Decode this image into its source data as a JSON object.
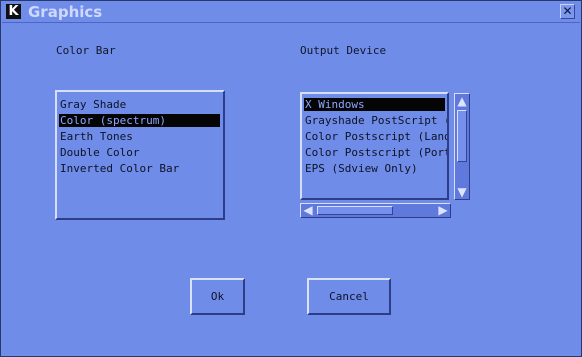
{
  "window": {
    "title": "Graphics",
    "app_icon": "K",
    "close_symbol": "✕"
  },
  "sections": {
    "color_bar": {
      "label": "Color Bar",
      "items": [
        {
          "label": "Gray Shade",
          "selected": false
        },
        {
          "label": "Color (spectrum)",
          "selected": true
        },
        {
          "label": "Earth Tones",
          "selected": false
        },
        {
          "label": "Double Color",
          "selected": false
        },
        {
          "label": "Inverted Color Bar",
          "selected": false
        }
      ]
    },
    "output_device": {
      "label": "Output Device",
      "items": [
        {
          "label": "X Windows",
          "selected": true
        },
        {
          "label": "Grayshade PostScript (Me",
          "selected": false
        },
        {
          "label": "Color Postscript (Landsc",
          "selected": false
        },
        {
          "label": "Color Postscript (Portra",
          "selected": false
        },
        {
          "label": "EPS (Sdview Only)",
          "selected": false
        }
      ]
    }
  },
  "buttons": {
    "ok": "Ok",
    "cancel": "Cancel"
  },
  "scroll_arrows": {
    "up": "▲",
    "down": "▼",
    "left": "◀",
    "right": "▶"
  }
}
